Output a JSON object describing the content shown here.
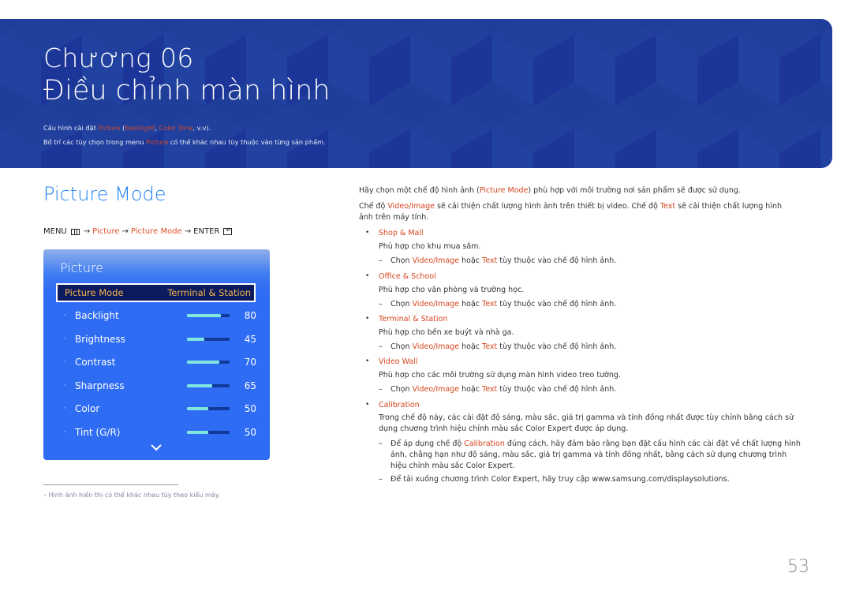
{
  "banner": {
    "chapter": "Chương 06",
    "title": "Điều chỉnh màn hình",
    "intro_line1": {
      "before": "Cấu hình cài đặt ",
      "picture": "Picture",
      "open": " (",
      "backlight": "Backlight",
      "comma": ", ",
      "color_tone": "Color Tone",
      "after": ", v.v)."
    },
    "intro_line2": {
      "before": "Bố trí các tùy chọn trong menu ",
      "picture": "Picture",
      "after": " có thể khác nhau tùy thuộc vào từng sản phẩm."
    }
  },
  "section": {
    "title": "Picture Mode",
    "path": {
      "menu": "MENU",
      "arrow": "→",
      "picture": "Picture",
      "picture_mode": "Picture Mode",
      "enter": "ENTER"
    }
  },
  "osd": {
    "title": "Picture",
    "selected": {
      "label": "Picture Mode",
      "value": "Terminal & Station"
    },
    "dot": "·",
    "rows": [
      {
        "label": "Backlight",
        "value": "80",
        "fraction": 0.8
      },
      {
        "label": "Brightness",
        "value": "45",
        "fraction": 0.4
      },
      {
        "label": "Contrast",
        "value": "70",
        "fraction": 0.75
      },
      {
        "label": "Sharpness",
        "value": "65",
        "fraction": 0.6
      },
      {
        "label": "Color",
        "value": "50",
        "fraction": 0.5
      },
      {
        "label": "Tint (G/R)",
        "value": "50",
        "fraction": 0.5
      }
    ],
    "more_icon": "chevron-down-icon"
  },
  "footnote": "–  Hình ảnh hiển thị có thể khác nhau tùy theo kiểu máy.",
  "right": {
    "p1": {
      "before": "Hãy chọn một chế độ hình ảnh (",
      "hl": "Picture Mode",
      "after": ") phù hợp với môi trường nơi sản phẩm sẽ được sử dụng."
    },
    "p2a": {
      "before": "Chế độ ",
      "hl1": "Video/Image",
      "mid": " sẽ cải thiện chất lượng hình ảnh trên thiết bị video. Chế độ ",
      "hl2": "Text",
      "after": " sẽ cải thiện chất lượng hình"
    },
    "p2b": "ảnh trên máy tính.",
    "choose_note": {
      "dash": "–",
      "before": "Chọn ",
      "hl1": "Video/Image",
      "mid": " hoặc ",
      "hl2": "Text",
      "after": " tùy thuộc vào chế độ hình ảnh."
    },
    "items": [
      {
        "title": "Shop & Mall",
        "desc": "Phù hợp cho khu mua sắm."
      },
      {
        "title": "Office & School",
        "desc": "Phù hợp cho văn phòng và trường học."
      },
      {
        "title": "Terminal & Station",
        "desc": "Phù hợp cho bến xe buýt và nhà ga."
      },
      {
        "title": "Video Wall",
        "desc": "Phù hợp cho các môi trường sử dụng màn hình video treo tường."
      }
    ],
    "calibration": {
      "title": "Calibration",
      "desc1": "Trong chế độ này, các cài đặt độ sáng, màu sắc, giá trị gamma và tính đồng nhất được tùy chỉnh bằng cách sử",
      "desc2a": "dụng chương trình hiệu chỉnh màu sắc ",
      "desc2b": "Color Expert",
      "desc2c": " được áp dụng.",
      "note1a": "Để áp dụng chế độ ",
      "note1b": "Calibration",
      "note1c": " đúng cách, hãy đảm bảo rằng bạn đặt cấu hình các cài đặt về chất lượng hình",
      "note1d": "ảnh, chẳng hạn như độ sáng, màu sắc, giá trị gamma và tính đồng nhất, bằng cách sử dụng chương trình",
      "note1e": "hiệu chỉnh màu sắc ",
      "note1f": "Color Expert",
      "note1g": ".",
      "note2a": "Để tải xuống chương trình ",
      "note2b": "Color Expert",
      "note2c": ", hãy truy cập www.samsung.com/displaysolutions."
    },
    "bullet": "•",
    "dash": "–"
  },
  "page_number": "53"
}
